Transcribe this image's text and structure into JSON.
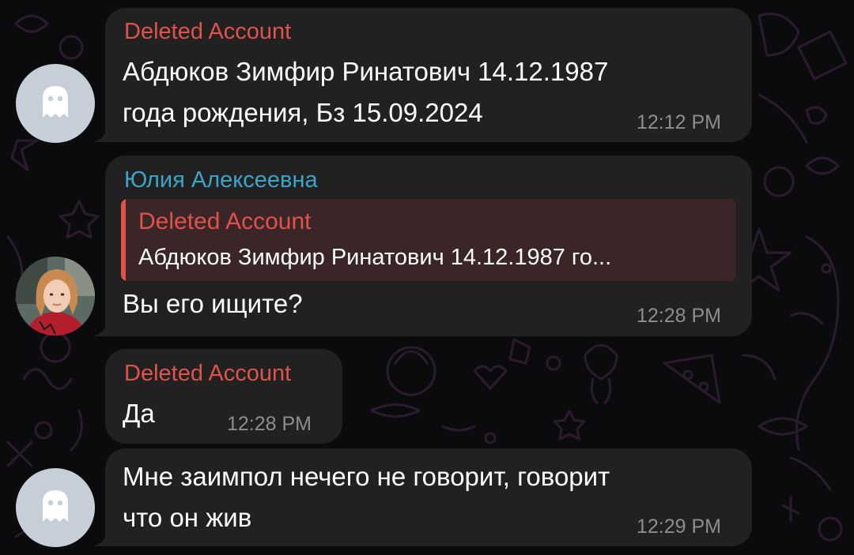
{
  "colors": {
    "background": "#0b0b0d",
    "bubble": "#212121",
    "deleted_sender": "#e0524b",
    "named_sender": "#3ca5c7",
    "reply_background": "#3b2627",
    "timestamp": "#8d8d8d"
  },
  "messages": [
    {
      "sender": "Deleted Account",
      "text_lines": [
        "Абдюков Зимфир Ринатович 14.12.1987",
        "года рождения, Бз 15.09.2024"
      ],
      "time": "12:12 PM",
      "avatar": "ghost-icon"
    },
    {
      "sender": "Юлия Алексеевна",
      "reply": {
        "sender": "Deleted Account",
        "text": "Абдюков Зимфир Ринатович 14.12.1987 го..."
      },
      "text_lines": [
        "Вы его ищите?"
      ],
      "time": "12:28 PM",
      "avatar": "profile-photo"
    },
    {
      "sender": "Deleted Account",
      "text_lines": [
        "Да"
      ],
      "time": "12:28 PM"
    },
    {
      "text_lines": [
        "Мне заимпол нечего не говорит, говорит",
        "что он жив"
      ],
      "time": "12:29 PM",
      "avatar": "ghost-icon"
    }
  ]
}
